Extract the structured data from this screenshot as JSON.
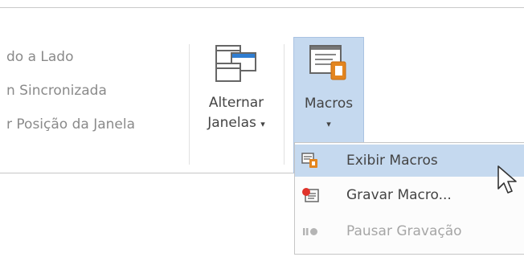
{
  "ribbon": {
    "left_items": [
      "do a Lado",
      "n Sincronizada",
      "r Posição da Janela"
    ],
    "switch_windows": {
      "line1": "Alternar",
      "line2": "Janelas",
      "chevron": "▾"
    },
    "macros": {
      "label": "Macros",
      "chevron": "▾"
    }
  },
  "macros_menu": {
    "items": [
      {
        "label": "Exibir Macros",
        "icon": "view-macros-icon",
        "enabled": true,
        "highlighted": true
      },
      {
        "label": "Gravar Macro...",
        "icon": "record-macro-icon",
        "enabled": true
      },
      {
        "label": "Pausar Gravação",
        "icon": "pause-recording-icon",
        "enabled": false
      }
    ]
  },
  "colors": {
    "accent_orange": "#e3851f",
    "record_red": "#e0332b",
    "selected_bg": "#c5d9ef",
    "disabled_text": "#a6a6a6"
  }
}
